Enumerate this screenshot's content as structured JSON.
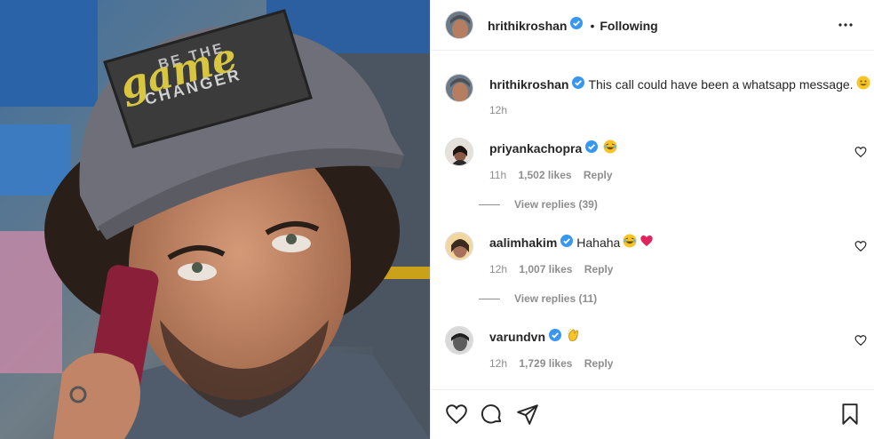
{
  "post": {
    "author": "hrithikroshan",
    "follow_status": "Following",
    "separator": "•",
    "caption": "This call could have been a whatsapp message.",
    "caption_time": "12h",
    "cap_text_top": "BE THE",
    "cap_text_script": "game",
    "cap_text_bottom": "CHANGER"
  },
  "comments": [
    {
      "user": "priyankachopra",
      "text": "",
      "time": "11h",
      "likes": "1,502 likes",
      "reply": "Reply",
      "view_replies": "View replies (39)"
    },
    {
      "user": "aalimhakim",
      "text": "Hahaha",
      "time": "12h",
      "likes": "1,007 likes",
      "reply": "Reply",
      "view_replies": "View replies (11)"
    },
    {
      "user": "varundvn",
      "text": "",
      "time": "12h",
      "likes": "1,729 likes",
      "reply": "Reply",
      "view_replies": ""
    }
  ],
  "colors": {
    "verified": "#3897f0",
    "meta": "#8e8e8e",
    "text": "#262626",
    "border": "#efefef"
  },
  "icons": [
    "verified-badge-icon",
    "more-options-icon",
    "heart-icon",
    "comment-icon",
    "share-icon",
    "bookmark-icon",
    "grinning-emoji-icon",
    "laughing-emoji-icon",
    "red-heart-emoji-icon",
    "clapping-emoji-icon"
  ]
}
